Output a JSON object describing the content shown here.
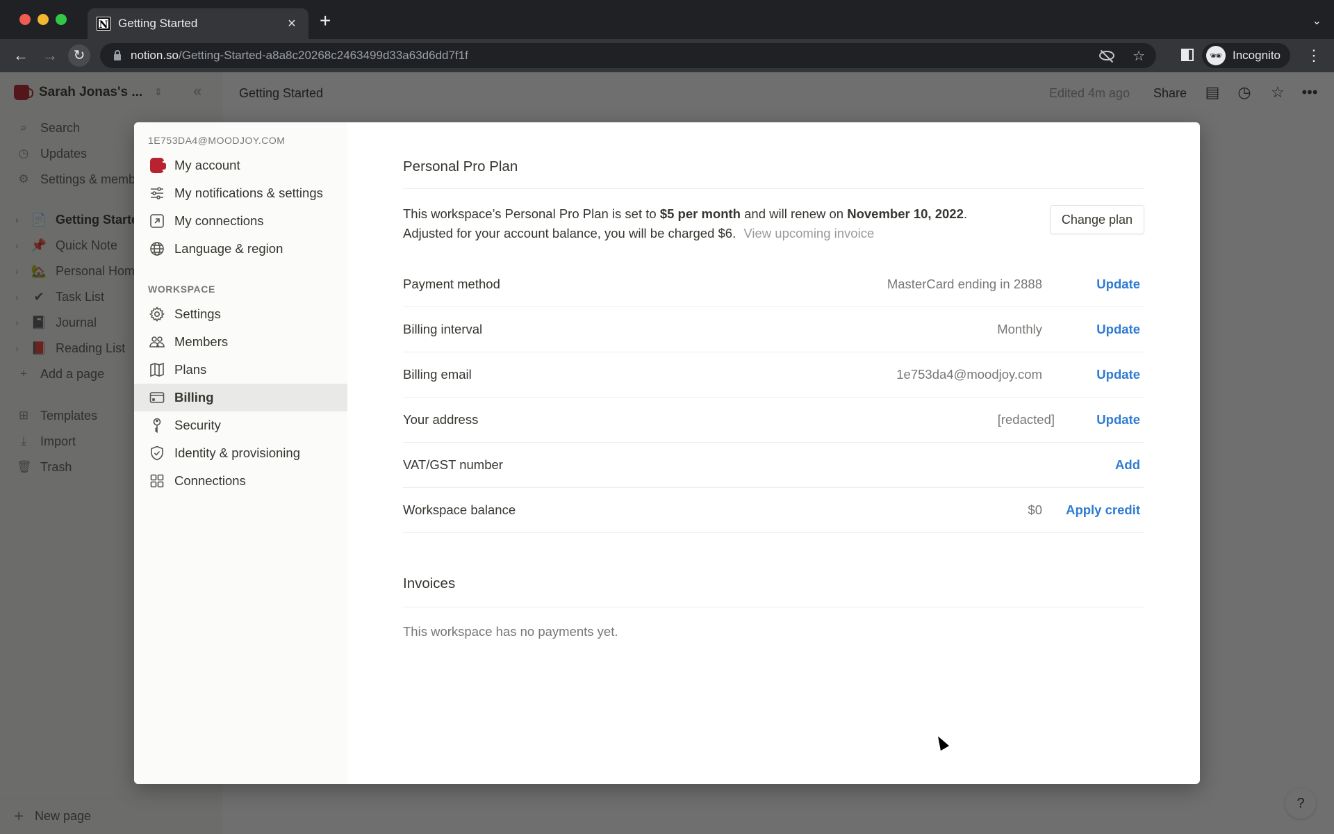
{
  "browser": {
    "tab_title": "Getting Started",
    "tab_favicon": "N",
    "url_host": "notion.so",
    "url_path": "/Getting-Started-a8a8c20268c2463499d33a63d6dd7f1f",
    "profile_label": "Incognito"
  },
  "workspace": {
    "name": "Sarah Jonas's ...",
    "nav": [
      {
        "label": "Search",
        "icon": "search-icon",
        "glyph": "⌕"
      },
      {
        "label": "Updates",
        "icon": "clock-icon",
        "glyph": "◷"
      },
      {
        "label": "Settings & members",
        "icon": "gear-icon",
        "glyph": "⚙"
      }
    ],
    "pages": [
      {
        "label": "Getting Started",
        "emoji": "📄"
      },
      {
        "label": "Quick Note",
        "emoji": "📌"
      },
      {
        "label": "Personal Home",
        "emoji": "🏡"
      },
      {
        "label": "Task List",
        "emoji": "✔"
      },
      {
        "label": "Journal",
        "emoji": "📓"
      },
      {
        "label": "Reading List",
        "emoji": "📕"
      }
    ],
    "add_page": "Add a page",
    "utilities": [
      {
        "label": "Templates",
        "glyph": "⊞"
      },
      {
        "label": "Import",
        "glyph": "⤓"
      },
      {
        "label": "Trash",
        "glyph": "🗑"
      }
    ],
    "new_page": "New page"
  },
  "topbar": {
    "breadcrumb": "Getting Started",
    "edited": "Edited 4m ago",
    "share": "Share"
  },
  "settings_modal": {
    "account_email": "1E753DA4@MOODJOY.COM",
    "account_items": [
      {
        "label": "My account"
      },
      {
        "label": "My notifications & settings"
      },
      {
        "label": "My connections"
      },
      {
        "label": "Language & region"
      }
    ],
    "workspace_heading": "WORKSPACE",
    "workspace_items": [
      {
        "label": "Settings"
      },
      {
        "label": "Members"
      },
      {
        "label": "Plans"
      },
      {
        "label": "Billing",
        "active": true
      },
      {
        "label": "Security"
      },
      {
        "label": "Identity & provisioning"
      },
      {
        "label": "Connections"
      }
    ]
  },
  "billing": {
    "plan_title": "Personal Pro Plan",
    "plan_sentence_start": "This workspace’s Personal Pro Plan is set to ",
    "plan_price": "$5 per month",
    "plan_sentence_mid": " and will renew on ",
    "renew_date": "November 10, 2022",
    "plan_sentence_end": ".",
    "charge_sentence": "Adjusted for your account balance, you will be charged $6.",
    "view_invoice": "View upcoming invoice",
    "change_plan": "Change plan",
    "rows": [
      {
        "label": "Payment method",
        "value": "MasterCard ending in 2888",
        "action": "Update"
      },
      {
        "label": "Billing interval",
        "value": "Monthly",
        "action": "Update"
      },
      {
        "label": "Billing email",
        "value": "1e753da4@moodjoy.com",
        "action": "Update"
      },
      {
        "label": "Your address",
        "value": "[redacted]",
        "action": "Update"
      },
      {
        "label": "VAT/GST number",
        "value": "",
        "action": "Add"
      },
      {
        "label": "Workspace balance",
        "value": "$0",
        "action": "Apply credit"
      }
    ],
    "invoices_title": "Invoices",
    "no_payments": "This workspace has no payments yet."
  },
  "colors": {
    "link_blue": "#2e7bd1",
    "active_item_bg": "#e9e9e7",
    "brand_mug_red": "#b8232f"
  }
}
